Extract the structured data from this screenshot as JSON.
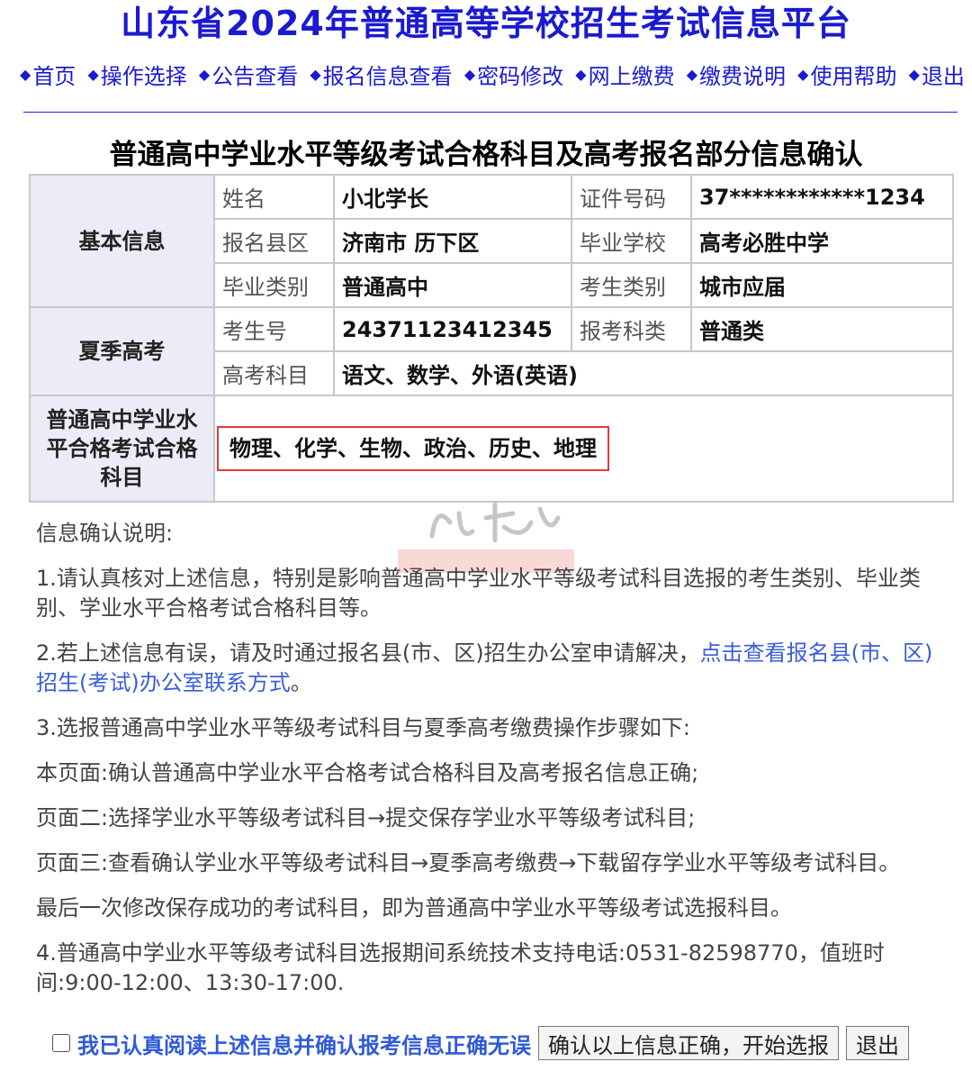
{
  "site": {
    "title": "山东省2024年普通高等学校招生考试信息平台"
  },
  "nav": {
    "items": [
      {
        "label": "首页"
      },
      {
        "label": "操作选择"
      },
      {
        "label": "公告查看"
      },
      {
        "label": "报名信息查看"
      },
      {
        "label": "密码修改"
      },
      {
        "label": "网上缴费"
      },
      {
        "label": "缴费说明"
      },
      {
        "label": "使用帮助"
      },
      {
        "label": "退出"
      }
    ]
  },
  "page": {
    "title": "普通高中学业水平等级考试合格科目及高考报名部分信息确认"
  },
  "table": {
    "basic": {
      "section": "基本信息",
      "name_label": "姓名",
      "name_value": "小北学长",
      "id_label": "证件号码",
      "id_value": "37************1234",
      "county_label": "报名县区",
      "county_value": "济南市 历下区",
      "school_label": "毕业学校",
      "school_value": "高考必胜中学",
      "grad_type_label": "毕业类别",
      "grad_type_value": "普通高中",
      "cand_type_label": "考生类别",
      "cand_type_value": "城市应届"
    },
    "summer": {
      "section": "夏季高考",
      "exam_no_label": "考生号",
      "exam_no_value": "24371123412345",
      "category_label": "报考科类",
      "category_value": "普通类",
      "subjects_label": "高考科目",
      "subjects_value": "语文、数学、外语(英语)"
    },
    "passed": {
      "section": "普通高中学业水平合格考试合格科目",
      "value": "物理、化学、生物、政治、历史、地理"
    }
  },
  "notes": {
    "heading": "信息确认说明:",
    "item1": "1.请认真核对上述信息，特别是影响普通高中学业水平等级考试科目选报的考生类别、毕业类别、学业水平合格考试合格科目等。",
    "item2_text": "2.若上述信息有误，请及时通过报名县(市、区)招生办公室申请解决，",
    "item2_link": "点击查看报名县(市、区)招生(考试)办公室联系方式",
    "item2_end": "。",
    "item3": "3.选报普通高中学业水平等级考试科目与夏季高考缴费操作步骤如下:",
    "step1": "本页面:确认普通高中学业水平合格考试合格科目及高考报名信息正确;",
    "step2": "页面二:选择学业水平等级考试科目→提交保存学业水平等级考试科目;",
    "step3": "页面三:查看确认学业水平等级考试科目→夏季高考缴费→下载留存学业水平等级考试科目。",
    "final": "最后一次修改保存成功的考试科目，即为普通高中学业水平等级考试选报科目。",
    "item4": "4.普通高中学业水平等级考试科目选报期间系统技术支持电话:0531-82598770，值班时间:9:00-12:00、13:30-17:00."
  },
  "confirm": {
    "ack_label": "我已认真阅读上述信息并确认报考信息正确无误",
    "confirm_button": "确认以上信息正确，开始选报",
    "exit_button": "退出"
  },
  "colors": {
    "brand_blue": "#1a1ad0",
    "link_blue": "#3a5ed8",
    "highlight_red": "#e23a3a",
    "section_bg": "#ececf8"
  }
}
